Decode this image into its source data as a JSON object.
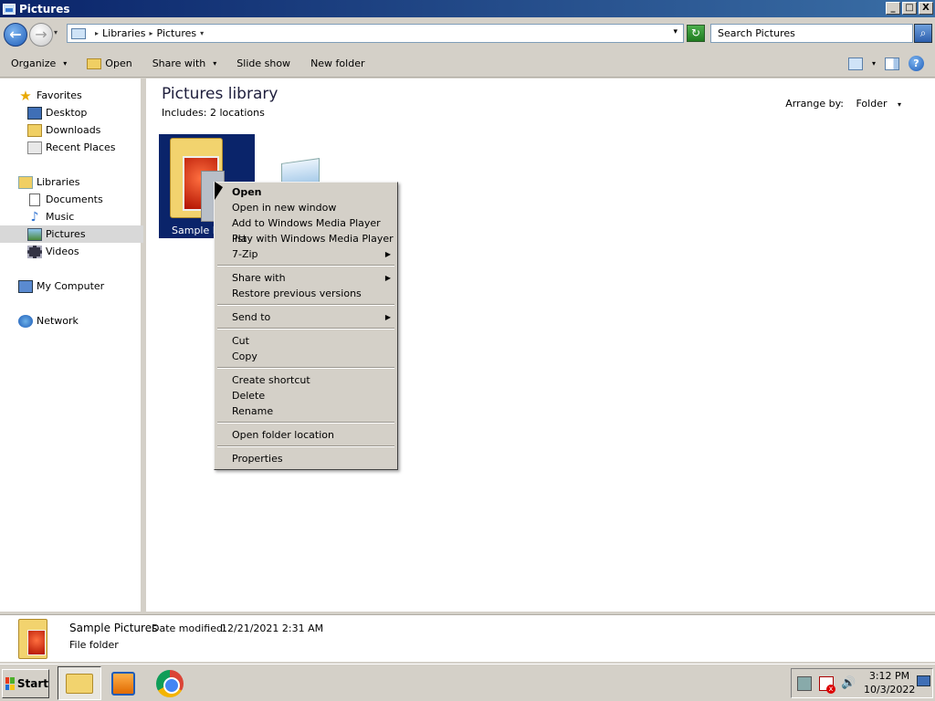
{
  "window": {
    "title": "Pictures",
    "min_label": "_",
    "max_label": "□",
    "close_label": "X"
  },
  "address": {
    "crumbs": [
      "Libraries",
      "Pictures"
    ],
    "sep": "▸",
    "dropdown": "▾",
    "back_glyph": "←",
    "fwd_glyph": "→",
    "refresh_glyph": "↻"
  },
  "search": {
    "placeholder": "Search Pictures",
    "glyph": "⌕"
  },
  "toolbar": {
    "organize": "Organize",
    "open": "Open",
    "share_with": "Share with",
    "slide_show": "Slide show",
    "new_folder": "New folder",
    "arrow": "▾",
    "help": "?"
  },
  "nav": {
    "favorites": "Favorites",
    "desktop": "Desktop",
    "downloads": "Downloads",
    "recent_places": "Recent Places",
    "libraries": "Libraries",
    "documents": "Documents",
    "music": "Music",
    "pictures": "Pictures",
    "videos": "Videos",
    "my_computer": "My Computer",
    "network": "Network"
  },
  "content": {
    "title": "Pictures library",
    "includes": "Includes:  2 locations",
    "arrange_label": "Arrange by:",
    "arrange_value": "Folder",
    "folder_label": "Sample Pictures"
  },
  "context_menu": {
    "open": "Open",
    "open_new_window": "Open in new window",
    "add_wmp": "Add to Windows Media Player list",
    "play_wmp": "Play with Windows Media Player",
    "seven_zip": "7-Zip",
    "share_with": "Share with",
    "restore": "Restore previous versions",
    "send_to": "Send to",
    "cut": "Cut",
    "copy": "Copy",
    "create_shortcut": "Create shortcut",
    "delete": "Delete",
    "rename": "Rename",
    "open_folder_location": "Open folder location",
    "properties": "Properties",
    "submenu_arrow": "▶"
  },
  "details": {
    "name": "Sample Pictures",
    "modified_label": "Date modified:",
    "modified_value": "12/21/2021 2:31 AM",
    "type": "File folder"
  },
  "taskbar": {
    "start": "Start",
    "time": "3:12 PM",
    "date": "10/3/2022",
    "volume_glyph": "🔊"
  },
  "colors": {
    "titlebar": "#0a246a",
    "selection": "#0a246a",
    "chrome": "#d4d0c8"
  }
}
